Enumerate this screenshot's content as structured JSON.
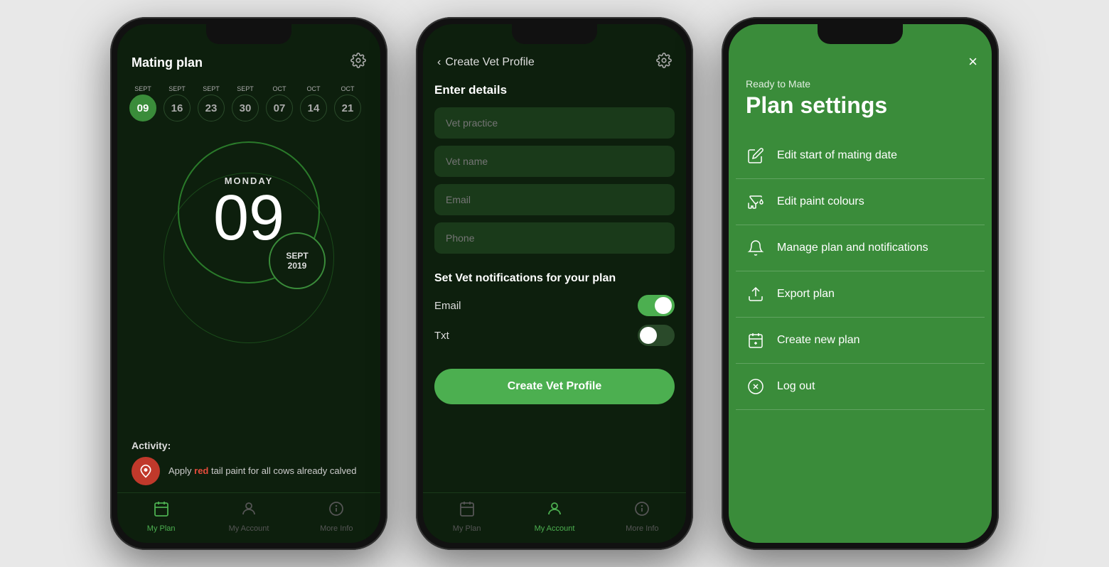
{
  "phone1": {
    "title": "Mating plan",
    "calendar": [
      {
        "month": "SEPT",
        "day": "09",
        "active": true
      },
      {
        "month": "SEPT",
        "day": "16",
        "active": false
      },
      {
        "month": "SEPT",
        "day": "23",
        "active": false
      },
      {
        "month": "SEPT",
        "day": "30",
        "active": false
      },
      {
        "month": "OCT",
        "day": "07",
        "active": false
      },
      {
        "month": "OCT",
        "day": "14",
        "active": false
      },
      {
        "month": "OCT",
        "day": "21",
        "active": false
      }
    ],
    "day_name": "MONDAY",
    "day_number": "09",
    "month": "SEPT",
    "year": "2019",
    "activity_label": "Activity:",
    "activity_text_1": "Apply ",
    "activity_text_bold": "red",
    "activity_text_2": " tail paint for all cows already calved",
    "nav": [
      {
        "label": "My Plan",
        "active": true
      },
      {
        "label": "My Account",
        "active": false
      },
      {
        "label": "More Info",
        "active": false
      }
    ]
  },
  "phone2": {
    "title": "Create Vet Profile",
    "section_title": "Enter details",
    "fields": [
      {
        "placeholder": "Vet practice"
      },
      {
        "placeholder": "Vet name"
      },
      {
        "placeholder": "Email"
      },
      {
        "placeholder": "Phone"
      }
    ],
    "notifications_title": "Set Vet notifications for your plan",
    "toggles": [
      {
        "label": "Email",
        "on": true
      },
      {
        "label": "Txt",
        "on": false
      }
    ],
    "cta_label": "Create Vet Profile",
    "nav": [
      {
        "label": "My Plan",
        "active": false
      },
      {
        "label": "My Account",
        "active": true
      },
      {
        "label": "More Info",
        "active": false
      }
    ]
  },
  "phone3": {
    "subtitle": "Ready to Mate",
    "title": "Plan settings",
    "close_label": "×",
    "menu_items": [
      {
        "label": "Edit start of mating date",
        "icon": "pencil"
      },
      {
        "label": "Edit paint colours",
        "icon": "paint"
      },
      {
        "label": "Manage plan and notifications",
        "icon": "bell"
      },
      {
        "label": "Export plan",
        "icon": "export"
      },
      {
        "label": "Create new plan",
        "icon": "plus-calendar"
      },
      {
        "label": "Log out",
        "icon": "circle-x"
      }
    ]
  },
  "icons": {
    "gear": "⚙",
    "back": "‹",
    "close": "×",
    "my_plan": "📅",
    "my_account": "👤",
    "more_info": "⊕"
  }
}
